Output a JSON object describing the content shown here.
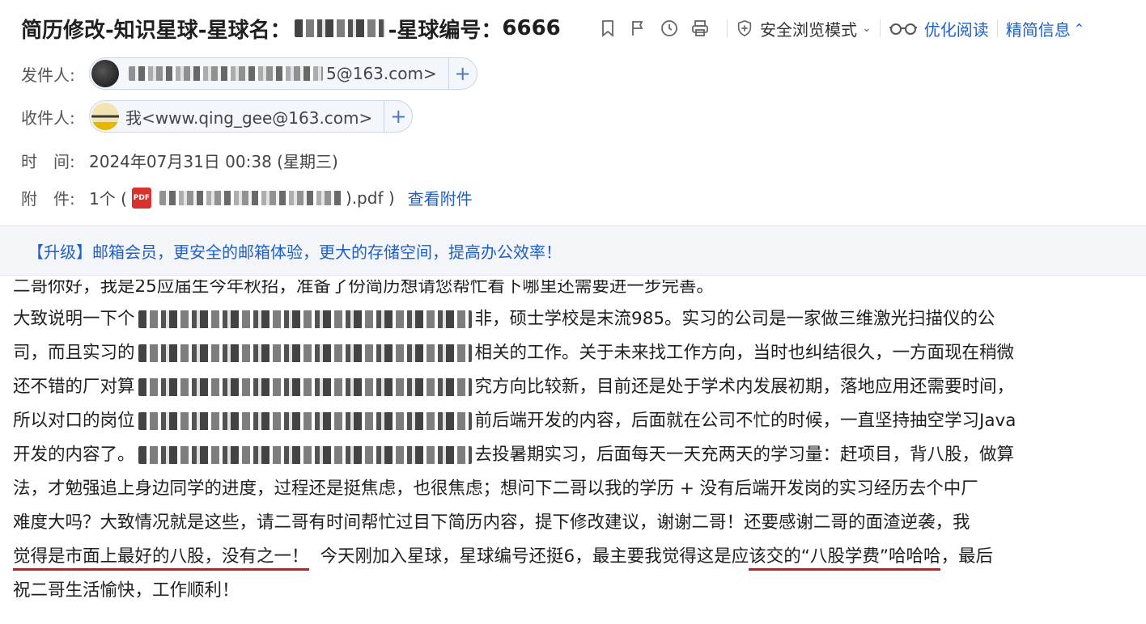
{
  "header": {
    "title_prefix": "简历修改-知识星球-星球名：",
    "title_suffix": "-星球编号：",
    "title_number": "6666",
    "safe_mode_label": "安全浏览模式",
    "optimize_read_label": "优化阅读",
    "info_label": "精简信息"
  },
  "meta": {
    "from_label": "发件人:",
    "from_email": "5@163.com>",
    "to_label": "收件人:",
    "to_email": "我<www.qing_gee@163.com>",
    "time_label": "时　间:",
    "time_value": "2024年07月31日 00:38 (星期三)",
    "attach_label": "附　件:",
    "attach_prefix": "1个 (",
    "attach_suffix": ").pdf )",
    "attach_view": "查看附件"
  },
  "banner": {
    "text": "【升级】邮箱会员，更安全的邮箱体验，更大的存储空间，提高办公效率！"
  },
  "body": {
    "line0": "二哥你好，我是25应届生今年秋招，准备了份简历想请您帮忙看下哪里还需要进一步完善。",
    "line1a": "大致说明一下个",
    "line1b": "非，硕士学校是末流985。实习的公司是一家做三维激光扫描仪的公",
    "line2a": "司，而且实习的",
    "line2b": "相关的工作。关于未来找工作方向，当时也纠结很久，一方面现在稍微",
    "line3a": "还不错的厂对算",
    "line3b": "究方向比较新，目前还是处于学术内发展初期，落地应用还需要时间，",
    "line4a": "所以对口的岗位",
    "line4b": "前后端开发的内容，后面就在公司不忙的时候，一直坚持抽空学习Java",
    "line5a": "开发的内容了。",
    "line5b": "去投暑期实习，后面每天一天充两天的学习量：赶项目，背八股，做算",
    "line6": "法，才勉强追上身边同学的进度，过程还是挺焦虑，也很焦虑；想问下二哥以我的学历 + 没有后端开发岗的实习经历去个中厂",
    "line7": "难度大吗？大致情况就是这些，请二哥有时间帮忙过目下简历内容，提下修改建议，谢谢二哥！还要感谢二哥的面渣逆袭，我",
    "line8a": "觉得是市面上最好的八股，没有之一！",
    "line8b": "今天刚加入星球，星球编号还挺6，最主要我觉得这是应",
    "line8c": "该交的“八股学费”哈哈哈",
    "line8d": "，最后",
    "line9": "祝二哥生活愉快，工作顺利！"
  },
  "colors": {
    "link": "#1e60c8",
    "underline": "#d0191b",
    "banner_bg": "#f3f5f9"
  }
}
